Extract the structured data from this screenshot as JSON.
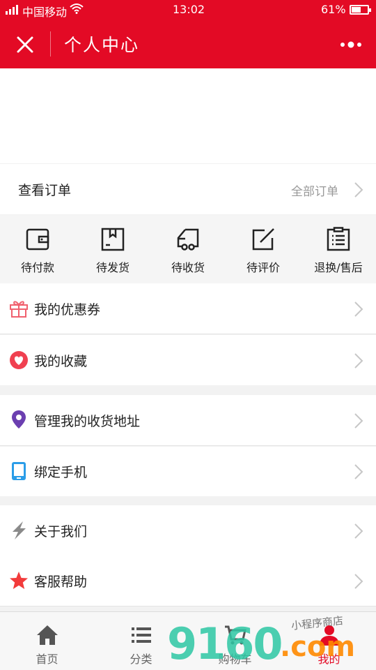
{
  "status_bar": {
    "network": "4G",
    "carrier": "中国移动",
    "time": "13:02",
    "battery_percent_label": "61%",
    "battery_level": 0.61
  },
  "header": {
    "title": "个人中心",
    "bg_color": "#e30a25",
    "close_icon": "close-icon",
    "more_icon": "more-dots-icon"
  },
  "orders": {
    "title": "查看订单",
    "all_label": "全部订单",
    "statuses": [
      {
        "label": "待付款",
        "icon": "wallet-icon"
      },
      {
        "label": "待发货",
        "icon": "package-icon"
      },
      {
        "label": "待收货",
        "icon": "truck-icon"
      },
      {
        "label": "待评价",
        "icon": "edit-icon"
      },
      {
        "label": "退换/售后",
        "icon": "clipboard-icon"
      }
    ]
  },
  "menu": {
    "group1": [
      {
        "label": "我的优惠券",
        "icon": "gift-icon"
      },
      {
        "label": "我的收藏",
        "icon": "heart-icon"
      }
    ],
    "group2": [
      {
        "label": "管理我的收货地址",
        "icon": "location-pin-icon"
      },
      {
        "label": "绑定手机",
        "icon": "phone-icon"
      }
    ],
    "group3": [
      {
        "label": "关于我们",
        "icon": "lightning-icon"
      },
      {
        "label": "客服帮助",
        "icon": "star-icon"
      }
    ]
  },
  "tabbar": {
    "tabs": [
      {
        "label": "首页",
        "icon": "home-icon"
      },
      {
        "label": "分类",
        "icon": "list-icon"
      },
      {
        "label": "购物车",
        "icon": "cart-icon"
      },
      {
        "label": "我的",
        "icon": "user-icon",
        "active": true
      }
    ],
    "active_color": "#e30a25"
  },
  "watermark": {
    "main": "9160",
    "domain": ".com",
    "tagline": "小程序商店"
  }
}
